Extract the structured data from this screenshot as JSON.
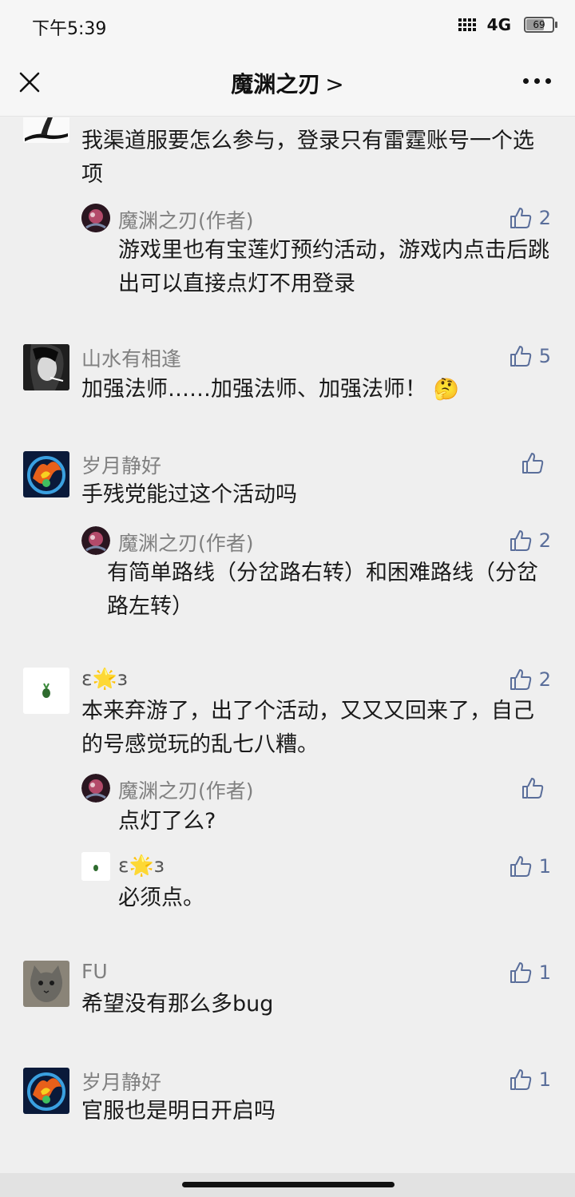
{
  "status": {
    "time": "下午5:39",
    "network": "4G",
    "battery": "69"
  },
  "nav": {
    "title": "魔渊之刃",
    "chevron": ">"
  },
  "comments": [
    {
      "text": "我渠道服要怎么参与，登录只有雷霆账号一个选项",
      "avatar": "ink-silhouette-avatar",
      "replies": [
        {
          "name": "魔渊之刃(作者)",
          "likes": "2",
          "text": "游戏里也有宝莲灯预约活动，游戏内点击后跳出可以直接点灯不用登录"
        }
      ]
    },
    {
      "name": "山水有相逢",
      "likes": "5",
      "text": "加强法师……加强法师、加强法师！",
      "emoji": "🤔",
      "avatar": "smoking-man-avatar"
    },
    {
      "name": "岁月静好",
      "likes": "",
      "text": "手残党能过这个活动吗",
      "avatar": "phoenix-avatar",
      "replies": [
        {
          "name": "魔渊之刃(作者)",
          "likes": "2",
          "text": "有简单路线（分岔路右转）和困难路线（分岔路左转）"
        }
      ]
    },
    {
      "name": "ε🌟з",
      "likes": "2",
      "text": "本来弃游了，出了个活动，又又又回来了，自己的号感觉玩的乱七八糟。",
      "avatar": "plant-avatar",
      "replies": [
        {
          "name": "魔渊之刃(作者)",
          "likes": "",
          "text": "点灯了么?"
        },
        {
          "name": "ε🌟з",
          "likes": "1",
          "text": "必须点。"
        }
      ]
    },
    {
      "name": "FU",
      "likes": "1",
      "text": "希望没有那么多bug",
      "avatar": "cat-avatar"
    },
    {
      "name": "岁月静好",
      "likes": "1",
      "text": "官服也是明日开启吗",
      "avatar": "phoenix-avatar"
    }
  ],
  "colors": {
    "background": "#efefef",
    "name": "#808080",
    "like": "#5a6e9a"
  }
}
